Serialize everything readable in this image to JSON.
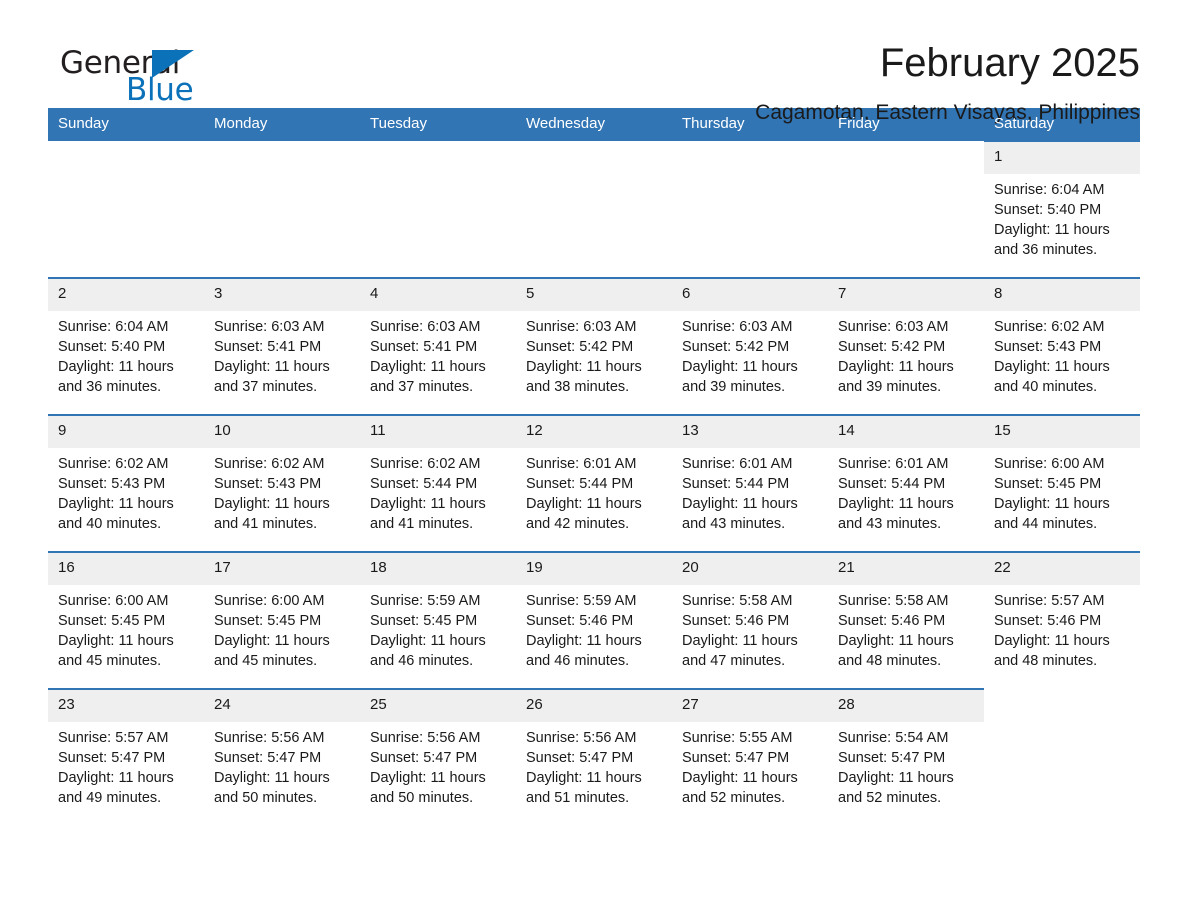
{
  "brand": {
    "name_part1": "General",
    "name_part2": "Blue",
    "accent_color": "#0b72b9"
  },
  "header": {
    "month_title": "February 2025",
    "location": "Cagamotan, Eastern Visayas, Philippines"
  },
  "theme": {
    "header_blue": "#3275b4",
    "daynum_band": "#efefef",
    "text": "#1a1a1a"
  },
  "weekday_headers": [
    "Sunday",
    "Monday",
    "Tuesday",
    "Wednesday",
    "Thursday",
    "Friday",
    "Saturday"
  ],
  "labels": {
    "sunrise_prefix": "Sunrise:",
    "sunset_prefix": "Sunset:",
    "daylight_prefix": "Daylight:"
  },
  "weeks": [
    [
      {
        "day": "",
        "empty": true
      },
      {
        "day": "",
        "empty": true
      },
      {
        "day": "",
        "empty": true
      },
      {
        "day": "",
        "empty": true
      },
      {
        "day": "",
        "empty": true
      },
      {
        "day": "",
        "empty": true
      },
      {
        "day": "1",
        "sunrise": "Sunrise: 6:04 AM",
        "sunset": "Sunset: 5:40 PM",
        "daylight_line1": "Daylight: 11 hours",
        "daylight_line2": "and 36 minutes."
      }
    ],
    [
      {
        "day": "2",
        "sunrise": "Sunrise: 6:04 AM",
        "sunset": "Sunset: 5:40 PM",
        "daylight_line1": "Daylight: 11 hours",
        "daylight_line2": "and 36 minutes."
      },
      {
        "day": "3",
        "sunrise": "Sunrise: 6:03 AM",
        "sunset": "Sunset: 5:41 PM",
        "daylight_line1": "Daylight: 11 hours",
        "daylight_line2": "and 37 minutes."
      },
      {
        "day": "4",
        "sunrise": "Sunrise: 6:03 AM",
        "sunset": "Sunset: 5:41 PM",
        "daylight_line1": "Daylight: 11 hours",
        "daylight_line2": "and 37 minutes."
      },
      {
        "day": "5",
        "sunrise": "Sunrise: 6:03 AM",
        "sunset": "Sunset: 5:42 PM",
        "daylight_line1": "Daylight: 11 hours",
        "daylight_line2": "and 38 minutes."
      },
      {
        "day": "6",
        "sunrise": "Sunrise: 6:03 AM",
        "sunset": "Sunset: 5:42 PM",
        "daylight_line1": "Daylight: 11 hours",
        "daylight_line2": "and 39 minutes."
      },
      {
        "day": "7",
        "sunrise": "Sunrise: 6:03 AM",
        "sunset": "Sunset: 5:42 PM",
        "daylight_line1": "Daylight: 11 hours",
        "daylight_line2": "and 39 minutes."
      },
      {
        "day": "8",
        "sunrise": "Sunrise: 6:02 AM",
        "sunset": "Sunset: 5:43 PM",
        "daylight_line1": "Daylight: 11 hours",
        "daylight_line2": "and 40 minutes."
      }
    ],
    [
      {
        "day": "9",
        "sunrise": "Sunrise: 6:02 AM",
        "sunset": "Sunset: 5:43 PM",
        "daylight_line1": "Daylight: 11 hours",
        "daylight_line2": "and 40 minutes."
      },
      {
        "day": "10",
        "sunrise": "Sunrise: 6:02 AM",
        "sunset": "Sunset: 5:43 PM",
        "daylight_line1": "Daylight: 11 hours",
        "daylight_line2": "and 41 minutes."
      },
      {
        "day": "11",
        "sunrise": "Sunrise: 6:02 AM",
        "sunset": "Sunset: 5:44 PM",
        "daylight_line1": "Daylight: 11 hours",
        "daylight_line2": "and 41 minutes."
      },
      {
        "day": "12",
        "sunrise": "Sunrise: 6:01 AM",
        "sunset": "Sunset: 5:44 PM",
        "daylight_line1": "Daylight: 11 hours",
        "daylight_line2": "and 42 minutes."
      },
      {
        "day": "13",
        "sunrise": "Sunrise: 6:01 AM",
        "sunset": "Sunset: 5:44 PM",
        "daylight_line1": "Daylight: 11 hours",
        "daylight_line2": "and 43 minutes."
      },
      {
        "day": "14",
        "sunrise": "Sunrise: 6:01 AM",
        "sunset": "Sunset: 5:44 PM",
        "daylight_line1": "Daylight: 11 hours",
        "daylight_line2": "and 43 minutes."
      },
      {
        "day": "15",
        "sunrise": "Sunrise: 6:00 AM",
        "sunset": "Sunset: 5:45 PM",
        "daylight_line1": "Daylight: 11 hours",
        "daylight_line2": "and 44 minutes."
      }
    ],
    [
      {
        "day": "16",
        "sunrise": "Sunrise: 6:00 AM",
        "sunset": "Sunset: 5:45 PM",
        "daylight_line1": "Daylight: 11 hours",
        "daylight_line2": "and 45 minutes."
      },
      {
        "day": "17",
        "sunrise": "Sunrise: 6:00 AM",
        "sunset": "Sunset: 5:45 PM",
        "daylight_line1": "Daylight: 11 hours",
        "daylight_line2": "and 45 minutes."
      },
      {
        "day": "18",
        "sunrise": "Sunrise: 5:59 AM",
        "sunset": "Sunset: 5:45 PM",
        "daylight_line1": "Daylight: 11 hours",
        "daylight_line2": "and 46 minutes."
      },
      {
        "day": "19",
        "sunrise": "Sunrise: 5:59 AM",
        "sunset": "Sunset: 5:46 PM",
        "daylight_line1": "Daylight: 11 hours",
        "daylight_line2": "and 46 minutes."
      },
      {
        "day": "20",
        "sunrise": "Sunrise: 5:58 AM",
        "sunset": "Sunset: 5:46 PM",
        "daylight_line1": "Daylight: 11 hours",
        "daylight_line2": "and 47 minutes."
      },
      {
        "day": "21",
        "sunrise": "Sunrise: 5:58 AM",
        "sunset": "Sunset: 5:46 PM",
        "daylight_line1": "Daylight: 11 hours",
        "daylight_line2": "and 48 minutes."
      },
      {
        "day": "22",
        "sunrise": "Sunrise: 5:57 AM",
        "sunset": "Sunset: 5:46 PM",
        "daylight_line1": "Daylight: 11 hours",
        "daylight_line2": "and 48 minutes."
      }
    ],
    [
      {
        "day": "23",
        "sunrise": "Sunrise: 5:57 AM",
        "sunset": "Sunset: 5:47 PM",
        "daylight_line1": "Daylight: 11 hours",
        "daylight_line2": "and 49 minutes."
      },
      {
        "day": "24",
        "sunrise": "Sunrise: 5:56 AM",
        "sunset": "Sunset: 5:47 PM",
        "daylight_line1": "Daylight: 11 hours",
        "daylight_line2": "and 50 minutes."
      },
      {
        "day": "25",
        "sunrise": "Sunrise: 5:56 AM",
        "sunset": "Sunset: 5:47 PM",
        "daylight_line1": "Daylight: 11 hours",
        "daylight_line2": "and 50 minutes."
      },
      {
        "day": "26",
        "sunrise": "Sunrise: 5:56 AM",
        "sunset": "Sunset: 5:47 PM",
        "daylight_line1": "Daylight: 11 hours",
        "daylight_line2": "and 51 minutes."
      },
      {
        "day": "27",
        "sunrise": "Sunrise: 5:55 AM",
        "sunset": "Sunset: 5:47 PM",
        "daylight_line1": "Daylight: 11 hours",
        "daylight_line2": "and 52 minutes."
      },
      {
        "day": "28",
        "sunrise": "Sunrise: 5:54 AM",
        "sunset": "Sunset: 5:47 PM",
        "daylight_line1": "Daylight: 11 hours",
        "daylight_line2": "and 52 minutes."
      },
      {
        "day": "",
        "empty": true
      }
    ]
  ]
}
